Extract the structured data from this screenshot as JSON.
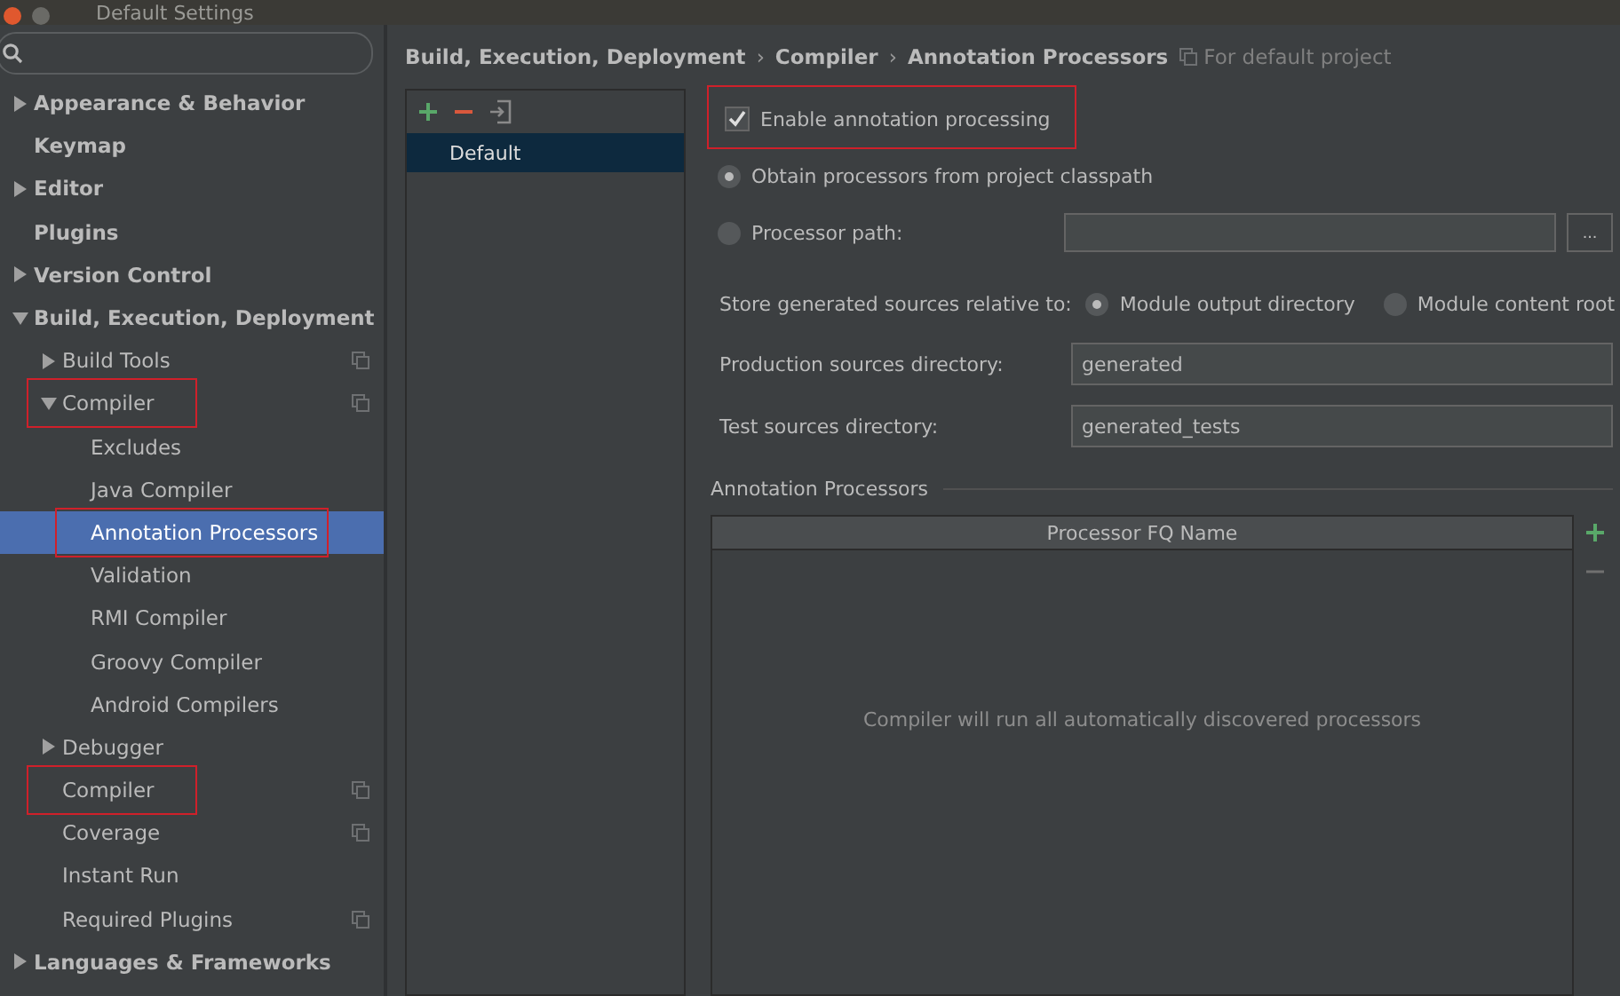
{
  "window": {
    "title": "Default Settings"
  },
  "sidebar": {
    "items": [
      {
        "label": "Appearance & Behavior",
        "expanded": false,
        "selected": false,
        "highlighted": false,
        "project_scoped": false
      },
      {
        "label": "Keymap",
        "selected": false,
        "highlighted": false,
        "project_scoped": false
      },
      {
        "label": "Editor",
        "expanded": false,
        "selected": false,
        "highlighted": false,
        "project_scoped": false
      },
      {
        "label": "Plugins",
        "selected": false,
        "highlighted": false,
        "project_scoped": false
      },
      {
        "label": "Version Control",
        "expanded": false,
        "selected": false,
        "highlighted": false,
        "project_scoped": false
      },
      {
        "label": "Build, Execution, Deployment",
        "expanded": true,
        "selected": false,
        "highlighted": false,
        "project_scoped": false,
        "children": [
          {
            "label": "Build Tools",
            "expanded": false,
            "selected": false,
            "highlighted": false,
            "project_scoped": true
          },
          {
            "label": "Compiler",
            "expanded": true,
            "selected": false,
            "highlighted": true,
            "project_scoped": true,
            "children": [
              {
                "label": "Excludes",
                "selected": false,
                "highlighted": false,
                "project_scoped": false
              },
              {
                "label": "Java Compiler",
                "selected": false,
                "highlighted": false,
                "project_scoped": false
              },
              {
                "label": "Annotation Processors",
                "selected": true,
                "highlighted": true,
                "project_scoped": false
              },
              {
                "label": "Validation",
                "selected": false,
                "highlighted": false,
                "project_scoped": false
              },
              {
                "label": "RMI Compiler",
                "selected": false,
                "highlighted": false,
                "project_scoped": false
              },
              {
                "label": "Groovy Compiler",
                "selected": false,
                "highlighted": false,
                "project_scoped": false
              },
              {
                "label": "Android Compilers",
                "selected": false,
                "highlighted": false,
                "project_scoped": false
              }
            ]
          },
          {
            "label": "Debugger",
            "expanded": false,
            "selected": false,
            "highlighted": false,
            "project_scoped": false
          },
          {
            "label": "Compiler",
            "selected": false,
            "highlighted": true,
            "project_scoped": true
          },
          {
            "label": "Coverage",
            "selected": false,
            "highlighted": false,
            "project_scoped": true
          },
          {
            "label": "Instant Run",
            "selected": false,
            "highlighted": false,
            "project_scoped": false
          },
          {
            "label": "Required Plugins",
            "selected": false,
            "highlighted": false,
            "project_scoped": true
          }
        ]
      },
      {
        "label": "Languages & Frameworks",
        "expanded": false,
        "selected": false,
        "highlighted": false,
        "project_scoped": false
      }
    ]
  },
  "breadcrumb": [
    "Build, Execution, Deployment",
    "Compiler",
    "Annotation Processors"
  ],
  "breadcrumb_separator": "›",
  "scope_note": "For default project",
  "profiles": [
    {
      "label": "Default",
      "selected": true
    }
  ],
  "enable": {
    "label": "Enable annotation processing",
    "checked": true,
    "highlighted": true
  },
  "source_options": [
    {
      "label": "Obtain processors from project classpath",
      "selected": true
    },
    {
      "label": "Processor path:",
      "selected": false
    }
  ],
  "browse_button": "...",
  "store_relative": {
    "label": "Store generated sources relative to:",
    "options": [
      {
        "label": "Module output directory",
        "selected": true
      },
      {
        "label": "Module content root",
        "selected": false
      }
    ]
  },
  "fields": [
    {
      "label": "Production sources directory:",
      "value": "generated"
    },
    {
      "label": "Test sources directory:",
      "value": "generated_tests"
    }
  ],
  "processors": {
    "title": "Annotation Processors",
    "columns": [
      "Processor FQ Name"
    ],
    "empty_text": "Compiler will run all automatically discovered processors"
  }
}
